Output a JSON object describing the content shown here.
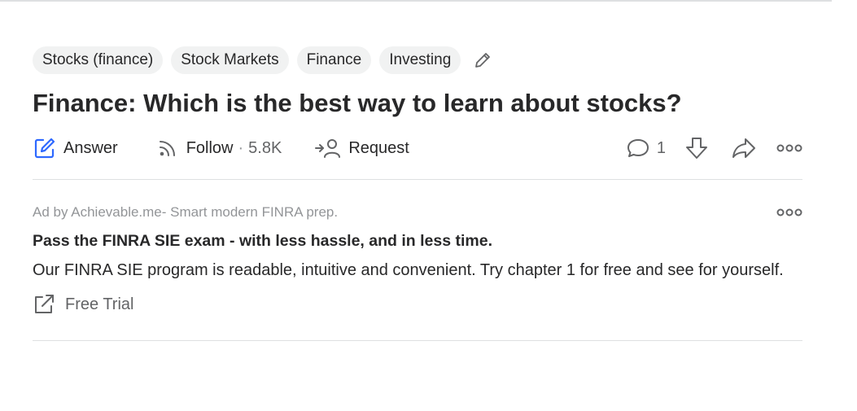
{
  "question": {
    "topics": [
      "Stocks (finance)",
      "Stock Markets",
      "Finance",
      "Investing"
    ],
    "title": "Finance: Which is the best way to learn about stocks?",
    "actions": {
      "answer_label": "Answer",
      "follow_label": "Follow",
      "follow_separator": "·",
      "follow_count": "5.8K",
      "request_label": "Request",
      "comment_count": "1"
    }
  },
  "ad": {
    "sponsor": "Ad by Achievable.me- Smart modern FINRA prep.",
    "headline": "Pass the FINRA SIE exam - with less hassle, and in less time.",
    "body": "Our FINRA SIE program is readable, intuitive and convenient. Try chapter 1 for free and see for yourself.",
    "cta_label": "Free Trial"
  },
  "colors": {
    "text": "#282829",
    "muted": "#636466",
    "answer_icon": "#2e69ff",
    "divider": "#dee0e1"
  },
  "icons": [
    "edit-pencil-icon",
    "answer-pencil-icon",
    "follow-rss-icon",
    "request-person-icon",
    "comment-icon",
    "downvote-icon",
    "share-icon",
    "more-options-icon",
    "external-link-icon"
  ]
}
